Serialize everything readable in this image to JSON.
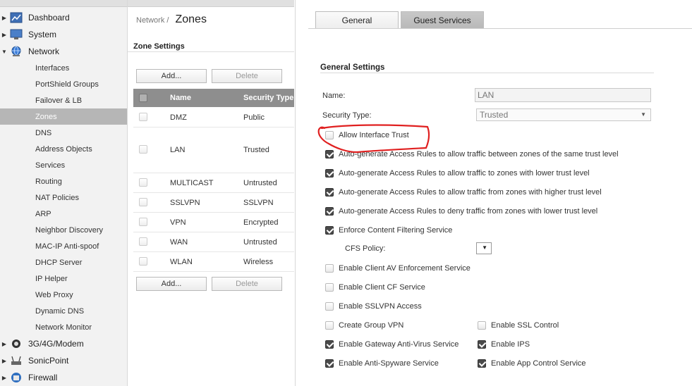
{
  "nav": {
    "groups": [
      {
        "label": "Dashboard",
        "icon": "dashboard-icon",
        "expanded": false
      },
      {
        "label": "System",
        "icon": "monitor-icon",
        "expanded": false
      },
      {
        "label": "Network",
        "icon": "globe-icon",
        "expanded": true
      },
      {
        "label": "3G/4G/Modem",
        "icon": "modem-icon",
        "expanded": false
      },
      {
        "label": "SonicPoint",
        "icon": "access-point-icon",
        "expanded": false
      },
      {
        "label": "Firewall",
        "icon": "firewall-icon",
        "expanded": false
      }
    ],
    "items": [
      "Interfaces",
      "PortShield Groups",
      "Failover & LB",
      "Zones",
      "DNS",
      "Address Objects",
      "Services",
      "Routing",
      "NAT Policies",
      "ARP",
      "Neighbor Discovery",
      "MAC-IP Anti-spoof",
      "DHCP Server",
      "IP Helper",
      "Web Proxy",
      "Dynamic DNS",
      "Network Monitor"
    ],
    "active_item": "Zones"
  },
  "breadcrumb": {
    "parent": "Network /",
    "current": "Zones"
  },
  "zone_settings": {
    "title": "Zone Settings",
    "add_label": "Add...",
    "delete_label": "Delete",
    "columns": [
      "Name",
      "Security Type"
    ],
    "rows": [
      {
        "name": "DMZ",
        "type": "Public"
      },
      {
        "name": "LAN",
        "type": "Trusted"
      },
      {
        "name": "MULTICAST",
        "type": "Untrusted"
      },
      {
        "name": "SSLVPN",
        "type": "SSLVPN"
      },
      {
        "name": "VPN",
        "type": "Encrypted"
      },
      {
        "name": "WAN",
        "type": "Untrusted"
      },
      {
        "name": "WLAN",
        "type": "Wireless"
      }
    ]
  },
  "tabs": [
    {
      "label": "General",
      "active": true
    },
    {
      "label": "Guest Services",
      "active": false
    }
  ],
  "general": {
    "title": "General Settings",
    "name_label": "Name:",
    "name_value": "LAN",
    "security_type_label": "Security Type:",
    "security_type_value": "Trusted",
    "cfs_policy_label": "CFS Policy:",
    "options": [
      {
        "label": "Allow Interface Trust",
        "checked": false
      },
      {
        "label": "Auto-generate Access Rules to allow traffic between zones of the same trust level",
        "checked": true
      },
      {
        "label": "Auto-generate Access Rules to allow traffic to zones with lower trust level",
        "checked": true
      },
      {
        "label": "Auto-generate Access Rules to allow traffic from zones with higher trust level",
        "checked": true
      },
      {
        "label": "Auto-generate Access Rules to deny traffic from zones with lower trust level",
        "checked": true
      },
      {
        "label": "Enforce Content Filtering Service",
        "checked": true
      },
      {
        "label": "Enable Client AV Enforcement Service",
        "checked": false
      },
      {
        "label": "Enable Client CF Service",
        "checked": false
      },
      {
        "label": "Enable SSLVPN Access",
        "checked": false
      },
      {
        "label": "Create Group VPN",
        "checked": false
      },
      {
        "label": "Enable Gateway Anti-Virus Service",
        "checked": true
      },
      {
        "label": "Enable Anti-Spyware Service",
        "checked": true
      },
      {
        "label": "Enable SSL Control",
        "checked": false
      },
      {
        "label": "Enable IPS",
        "checked": true
      },
      {
        "label": "Enable App Control Service",
        "checked": true
      }
    ]
  },
  "annotation_color": "#e02020"
}
